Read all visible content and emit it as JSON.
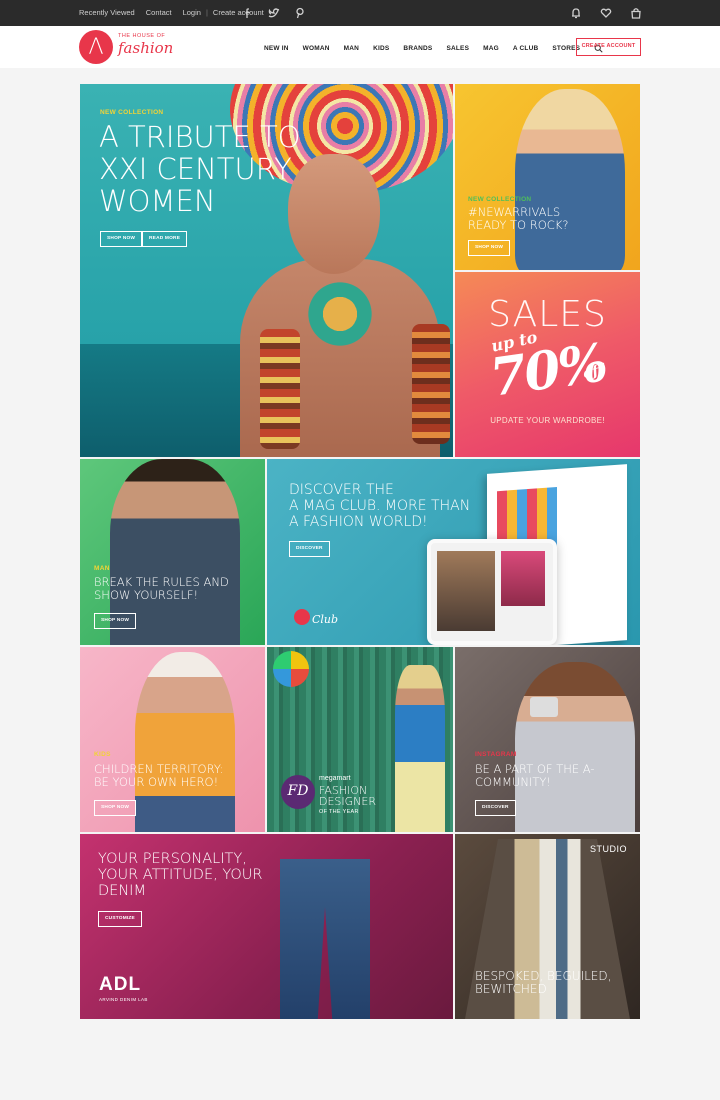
{
  "topbar": {
    "recently_viewed": "Recently Viewed",
    "contact": "Contact",
    "login": "Login",
    "separator": "|",
    "create_account": "Create account",
    "social_icons": [
      "facebook-icon",
      "twitter-icon",
      "pinterest-icon"
    ],
    "right_icons": [
      "bell-icon",
      "heart-icon",
      "bag-icon"
    ]
  },
  "header": {
    "logo_letter": "Λ",
    "logo_small": "THE HOUSE OF",
    "logo_script": "fashion",
    "nav": [
      "NEW IN",
      "WOMAN",
      "MAN",
      "KIDS",
      "BRANDS",
      "SALES",
      "MAG",
      "A CLUB",
      "STORES"
    ],
    "create_account_button": "CREATE ACCOUNT"
  },
  "tiles": {
    "hero": {
      "sub": "NEW COLLECTION",
      "headline": "A TRIBUTE TO XXI CENTURY WOMEN",
      "btn1": "SHOP NOW",
      "btn2": "READ MORE"
    },
    "denim": {
      "sub": "NEW COLLECTION",
      "headline": "#NEWARRIVALS READY TO ROCK?",
      "btn": "SHOP NOW"
    },
    "sales": {
      "big": "SALES",
      "upto": "up to",
      "pct": "70%",
      "off": "off",
      "update": "UPDATE YOUR WARDROBE!"
    },
    "man": {
      "sub": "MAN",
      "headline": "BREAK THE RULES AND SHOW YOURSELF!",
      "btn": "SHOP NOW"
    },
    "club": {
      "headline_1": "DISCOVER THE",
      "headline_2": "A MAG CLUB. MORE THAN",
      "headline_3": "A FASHION WORLD!",
      "btn": "DISCOVER",
      "logo_word": "Club"
    },
    "kids": {
      "sub": "KIDS",
      "headline": "CHILDREN TERRITORY: BE YOUR OWN HERO!",
      "btn": "SHOP NOW"
    },
    "designer": {
      "badge": "FD",
      "brand": "megamart",
      "title": "FASHION DESIGNER",
      "year": "OF THE YEAR"
    },
    "community": {
      "sub": "INSTAGRAM",
      "headline": "BE A PART OF THE A-COMMUNITY!",
      "btn": "DISCOVER"
    },
    "denimlab": {
      "headline": "YOUR PERSONALITY, YOUR ATTITUDE, YOUR DENIM",
      "btn": "CUSTOMIZE",
      "logo": "ADL",
      "logo_sub": "ARVIND DENIM LAB"
    },
    "studio": {
      "label": "STUDIO",
      "headline": "BESPOKED, BEGUILED, BEWITCHED"
    }
  },
  "colors": {
    "accent": "#e8364a",
    "topbar": "#2b2b2b",
    "sub_yellow": "#f2d335",
    "sub_green": "#4fbf5a",
    "sub_pink": "#e8364a"
  }
}
